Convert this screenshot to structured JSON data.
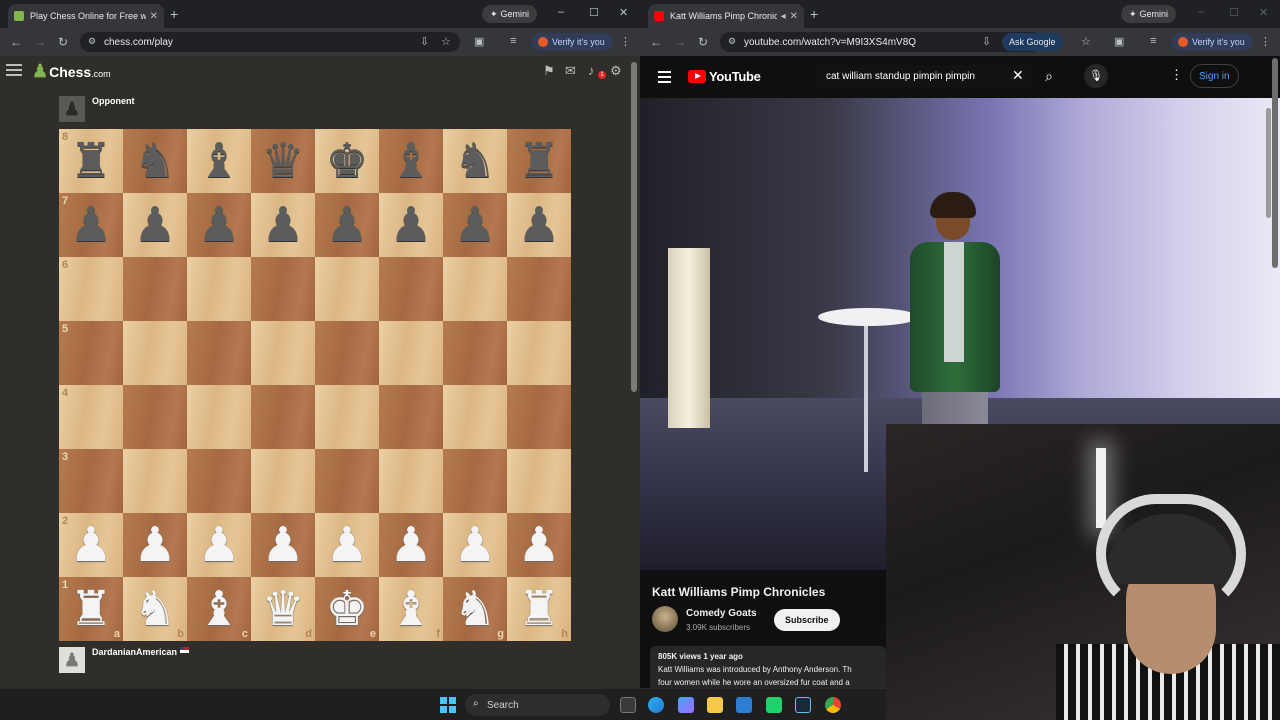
{
  "left_window": {
    "tab": {
      "title": "Play Chess Online for Free with",
      "close": "✕"
    },
    "new_tab": "+",
    "gemini": "Gemini",
    "controls": {
      "min": "–",
      "max": "☐",
      "close": "✕"
    },
    "url": "chess.com/play",
    "verify": "Verify it's you"
  },
  "chess": {
    "logo": "Chess",
    "logo_suffix": ".com",
    "opponent": "Opponent",
    "player": "DardanianAmerican",
    "notification_count": "1",
    "ranks": [
      "8",
      "7",
      "6",
      "5",
      "4",
      "3",
      "2",
      "1"
    ],
    "files": [
      "a",
      "b",
      "c",
      "d",
      "e",
      "f",
      "g",
      "h"
    ],
    "position": [
      [
        "bR",
        "bN",
        "bB",
        "bQ",
        "bK",
        "bB",
        "bN",
        "bR"
      ],
      [
        "bP",
        "bP",
        "bP",
        "bP",
        "bP",
        "bP",
        "bP",
        "bP"
      ],
      [
        "",
        "",
        "",
        "",
        "",
        "",
        "",
        ""
      ],
      [
        "",
        "",
        "",
        "",
        "",
        "",
        "",
        ""
      ],
      [
        "",
        "",
        "",
        "",
        "",
        "",
        "",
        ""
      ],
      [
        "",
        "",
        "",
        "",
        "",
        "",
        "",
        ""
      ],
      [
        "wP",
        "wP",
        "wP",
        "wP",
        "wP",
        "wP",
        "wP",
        "wP"
      ],
      [
        "wR",
        "wN",
        "wB",
        "wQ",
        "wK",
        "wB",
        "wN",
        "wR"
      ]
    ],
    "light_color": "#e8c99b",
    "dark_color": "#b0744a"
  },
  "right_window": {
    "tab": {
      "title": "Katt Williams Pimp Chronic",
      "close": "✕"
    },
    "new_tab": "+",
    "gemini": "Gemini",
    "controls": {
      "min": "–",
      "max": "☐",
      "close": "✕"
    },
    "url": "youtube.com/watch?v=M9I3XS4mV8Q",
    "ask_google": "Ask Google",
    "verify": "Verify it's you"
  },
  "youtube": {
    "logo": "YouTube",
    "search_value": "cat william standup pimpin pimpin",
    "sign_in": "Sign in",
    "video_title": "Katt Williams Pimp Chronicles",
    "channel_name": "Comedy Goats",
    "subscribers": "3.09K subscribers",
    "subscribe": "Subscribe",
    "meta": "805K views  1 year ago",
    "description_line1": "Katt Williams was introduced by Anthony Anderson. Th",
    "description_line2": "four women while he wore an oversized fur coat and a"
  },
  "taskbar": {
    "search_placeholder": "Search",
    "accent": "#4cc2ff"
  }
}
